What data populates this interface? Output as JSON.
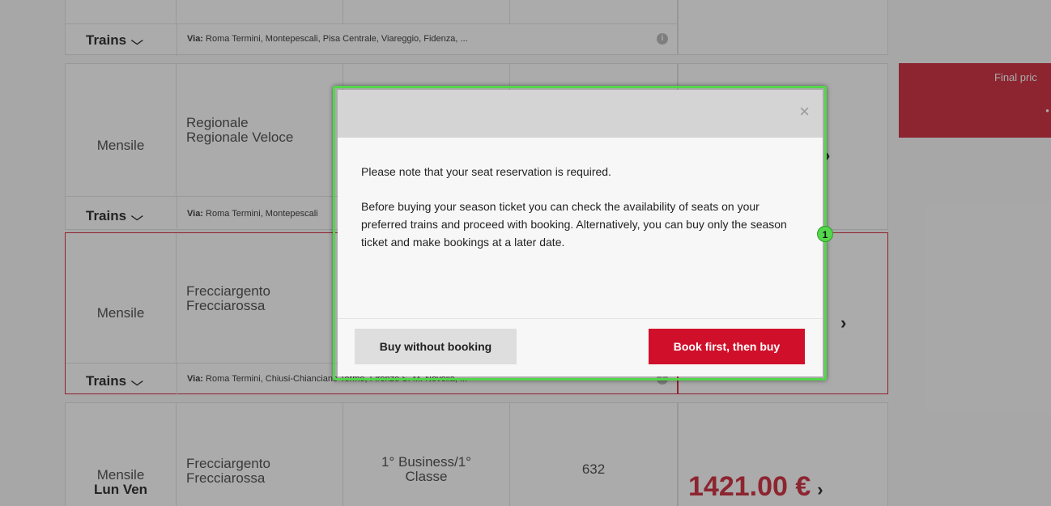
{
  "table": {
    "row0": {
      "trains_label": "Trains",
      "via_label": "Via:",
      "via_text": " Roma Termini, Montepescali, Pisa Centrale, Viareggio, Fidenza, ..."
    },
    "row1": {
      "ticket_type": "Mensile",
      "train_line1": "Regionale",
      "train_line2": "Regionale Veloce",
      "trains_label": "Trains",
      "via_label": "Via:",
      "via_text": " Roma Termini, Montepescali"
    },
    "row2": {
      "ticket_type": "Mensile",
      "train_line1": "Frecciargento",
      "train_line2": "Frecciarossa",
      "trains_label": "Trains",
      "via_label": "Via:",
      "via_text": " Roma Termini, Chiusi-Chianciano Terme, Firenze S. M. Novella, ..."
    },
    "row3": {
      "ticket_type": "Mensile",
      "days": "Lun Ven",
      "train_line1": "Frecciargento",
      "train_line2": "Frecciarossa",
      "class_line1": "1° Business/1°",
      "class_line2": "Classe",
      "seats": "632",
      "price": "1421.00 €"
    }
  },
  "final_price_label": "Final pric",
  "modal": {
    "close_glyph": "×",
    "message1": "Please note that your seat reservation is required.",
    "message2": "Before buying your season ticket you can check the availability of seats on your preferred trains and proceed with booking. Alternatively, you can buy only the season ticket and make bookings at a later date.",
    "secondary_button": "Buy without booking",
    "primary_button": "Book first, then buy"
  },
  "annotation_badge": "1",
  "colors": {
    "accent_red": "#d0102a",
    "highlight_green": "#53d64a",
    "price_red": "#d13848"
  },
  "icons": {
    "chevron": "chevron-down-icon",
    "arrow": "chevron-right-icon",
    "info": "info-icon",
    "close": "close-icon"
  }
}
